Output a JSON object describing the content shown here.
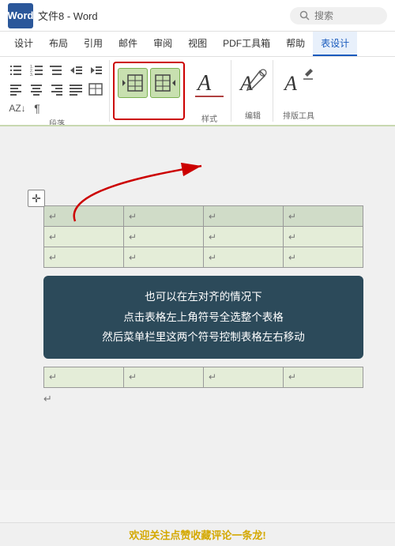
{
  "titlebar": {
    "app_name": "Word",
    "file_name": "文件8 - Word",
    "search_placeholder": "搜索"
  },
  "ribbon": {
    "tabs": [
      {
        "label": "设计",
        "active": false
      },
      {
        "label": "布局",
        "active": false
      },
      {
        "label": "引用",
        "active": false
      },
      {
        "label": "邮件",
        "active": false
      },
      {
        "label": "审阅",
        "active": false
      },
      {
        "label": "视图",
        "active": false
      },
      {
        "label": "PDF工具箱",
        "active": false
      },
      {
        "label": "帮助",
        "active": false
      },
      {
        "label": "表设计",
        "active": true
      }
    ],
    "groups": {
      "paragraph_label": "段落",
      "style_label": "样式",
      "edit_label": "编辑",
      "layout_label": "排版工具"
    },
    "align_buttons": [
      "≡≡",
      "≡≡"
    ],
    "style_btn": "样式",
    "edit_btn": "编辑",
    "layout_btn": "排版工具"
  },
  "tooltip": {
    "line1": "也可以在左对齐的情况下",
    "line2": "点击表格左上角符号全选整个表格",
    "line3": "然后菜单栏里这两个符号控制表格左右移动"
  },
  "bottom": {
    "text": "欢迎关注点赞收藏评论一条龙!"
  },
  "table": {
    "rows": 3,
    "cols": 4
  }
}
